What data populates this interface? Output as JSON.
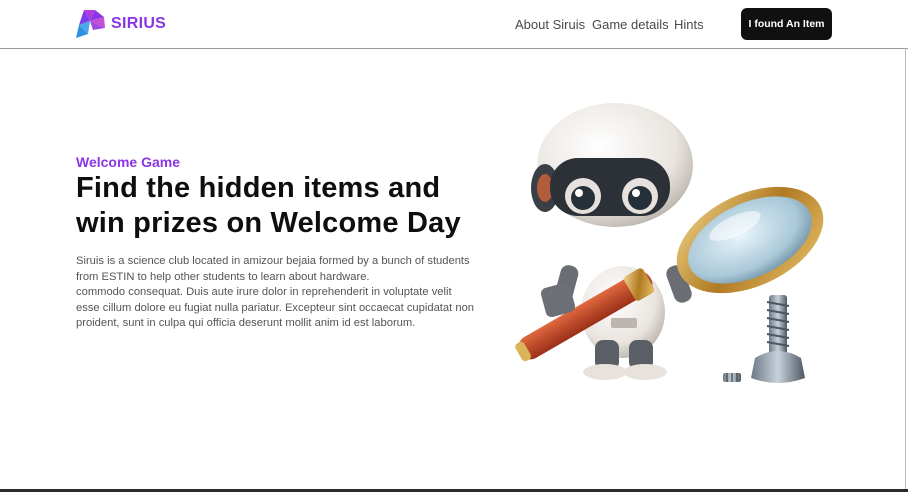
{
  "brand": {
    "name": "SIRIUS",
    "accent": "#8a35e6",
    "accent2": "#2fa7ea"
  },
  "nav": {
    "items": [
      {
        "label": "About Siruis"
      },
      {
        "label": "Game details"
      },
      {
        "label": "Hints"
      }
    ],
    "cta_label": "I found An Item"
  },
  "hero": {
    "eyebrow": "Welcome Game",
    "title_line1": "Find the hidden items and",
    "title_line2": "win prizes on Welcome Day",
    "description_lines": [
      "Siruis is a science club located in amizour bejaia formed by a bunch of students",
      "from ESTIN to help other students to learn about hardware.",
      "commodo consequat. Duis aute irure dolor in reprehenderit in voluptate velit",
      "esse cillum dolore eu fugiat nulla pariatur. Excepteur sint occaecat cupidatat non",
      "proident, sunt in culpa qui officia deserunt mollit anim id est laborum."
    ],
    "image_subject": "robot-with-magnifying-glass-icon"
  },
  "colors": {
    "cta_bg": "#101010",
    "cta_text": "#ffffff",
    "title": "#0e0e0e",
    "body_text": "#555555"
  }
}
